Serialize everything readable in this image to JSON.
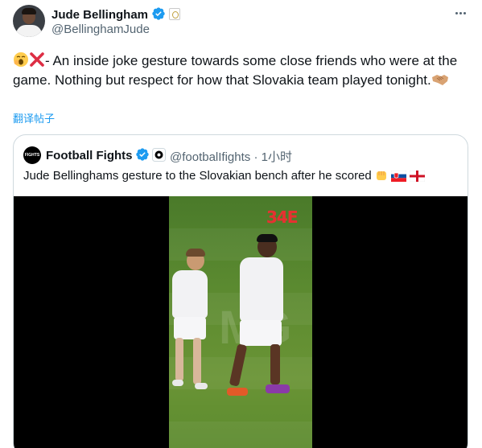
{
  "tweet": {
    "author_name": "Jude Bellingham",
    "author_handle": "@BellinghamJude",
    "text": "- An inside joke gesture towards some close friends who were at the game. Nothing but respect for how that Slovakia team played tonight.",
    "translate_label": "翻译帖子"
  },
  "icons": {
    "verified": "verified-badge-icon",
    "affiliate": "real-madrid-crest-icon",
    "more": "more-options-icon",
    "emoji_1": "yawning-face-emoji",
    "emoji_2": "cross-mark-emoji",
    "emoji_3": "handshake-emoji"
  },
  "quote": {
    "author_name": "Football Fights",
    "author_handle": "@footbalIfights",
    "time": "· 1小时",
    "avatar_text": "FIGHTS",
    "text": "Jude Bellinghams gesture to the Slovakian bench after he scored",
    "text_emojis": [
      "fist-emoji",
      "slovakia-flag-emoji",
      "england-flag-emoji"
    ],
    "video_logo": "34E",
    "video_watermark": "MG"
  },
  "colors": {
    "text": "#0f1419",
    "secondary": "#536471",
    "link": "#1d9bf0",
    "verified": "#1d9bf0",
    "border": "#cfd9de"
  }
}
